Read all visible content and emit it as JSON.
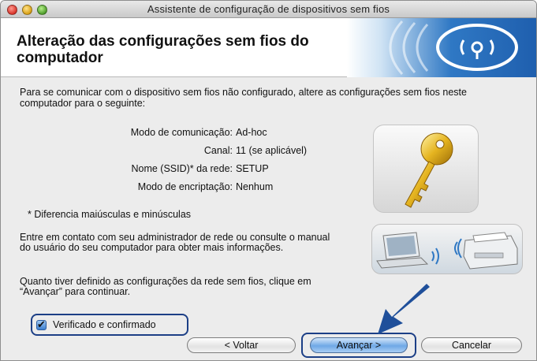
{
  "window": {
    "title": "Assistente de configuração de dispositivos sem fios"
  },
  "header": {
    "title_line1": "Alteração das configurações sem fios do",
    "title_line2": "computador",
    "icon": "wifi-signal-icon"
  },
  "intro": "Para se comunicar com o dispositivo sem fios não configurado, altere as configurações sem fios neste computador para o seguinte:",
  "settings": [
    {
      "label": "Modo de comunicação:",
      "value": "Ad-hoc"
    },
    {
      "label": "Canal:",
      "value": "11  (se aplicável)"
    },
    {
      "label": "Nome (SSID)* da rede:",
      "value": "SETUP"
    },
    {
      "label": "Modo de encriptação:",
      "value": "Nenhum"
    }
  ],
  "note": "* Diferencia maiúsculas e minúsculas",
  "contact": "Entre em contato com seu administrador de rede ou consulte o manual do usuário do seu computador para obter mais informações.",
  "continue_text": "Quanto tiver definido as configurações da rede sem fios, clique em “Avançar” para continuar.",
  "checkbox": {
    "label": "Verificado e confirmado",
    "checked": true
  },
  "buttons": {
    "back": "< Voltar",
    "next": "Avançar >",
    "cancel": "Cancelar"
  },
  "colors": {
    "accent": "#1c3f86",
    "banner_blue": "#2f78c4"
  }
}
